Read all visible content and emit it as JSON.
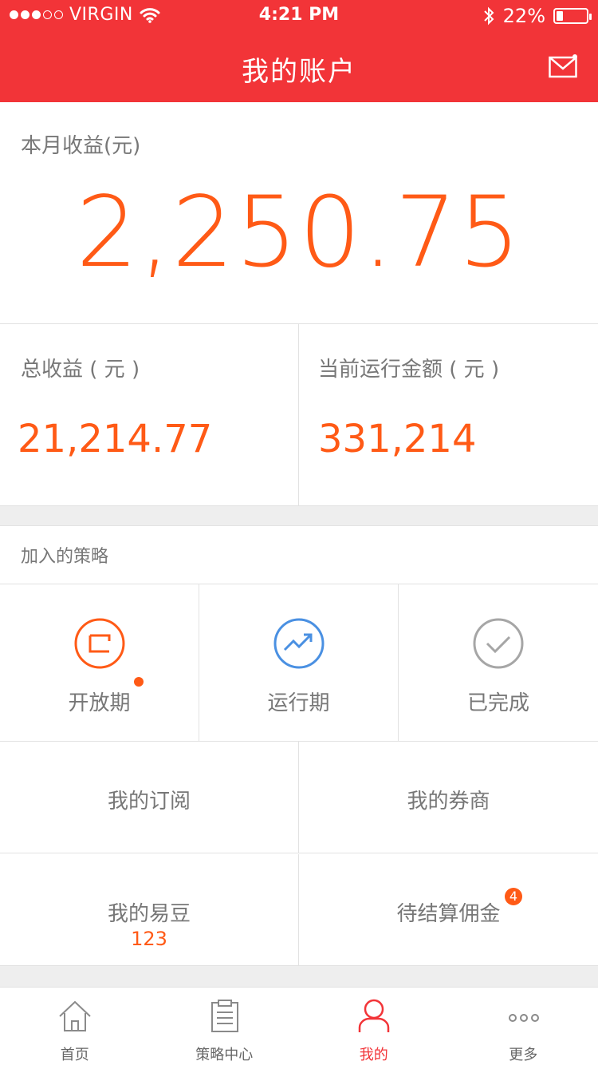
{
  "status_bar": {
    "carrier": "VIRGIN",
    "time": "4:21 PM",
    "battery": "22%"
  },
  "header": {
    "title": "我的账户"
  },
  "earnings": {
    "month_label": "本月收益(元)",
    "month_value": "2,250.75",
    "total_label": "总收益 ( 元 )",
    "total_value": "21,214.77",
    "running_label": "当前运行金额 ( 元 )",
    "running_value": "331,214"
  },
  "strategies": {
    "title": "加入的策略",
    "items": [
      {
        "label": "开放期",
        "icon": "open-period-icon"
      },
      {
        "label": "运行期",
        "icon": "trend-icon"
      },
      {
        "label": "已完成",
        "icon": "check-icon"
      }
    ]
  },
  "menu": {
    "subscriptions": "我的订阅",
    "brokers": "我的券商",
    "yidou_label": "我的易豆",
    "yidou_value": "123",
    "commission_label": "待结算佣金",
    "commission_badge": "4"
  },
  "tabbar": [
    {
      "label": "首页",
      "icon": "home-icon"
    },
    {
      "label": "策略中心",
      "icon": "clipboard-icon"
    },
    {
      "label": "我的",
      "icon": "user-icon"
    },
    {
      "label": "更多",
      "icon": "more-icon"
    }
  ],
  "colors": {
    "brand_red": "#f23438",
    "accent_orange": "#ff5a16",
    "blue": "#4a90e2",
    "gray": "#a6a6a6"
  }
}
